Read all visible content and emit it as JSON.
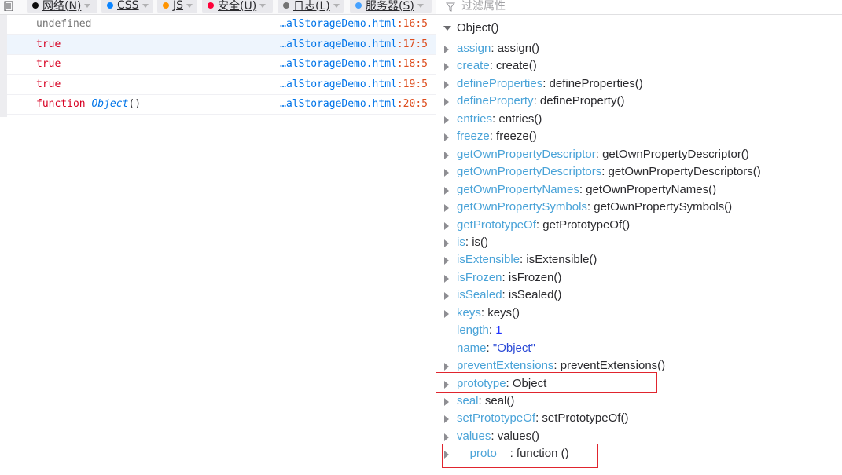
{
  "toolbar": {
    "filters": [
      {
        "label": "网络(N)",
        "dot_color": "#0c0c0d"
      },
      {
        "label": "CSS",
        "dot_color": "#0a84ff"
      },
      {
        "label": "JS",
        "dot_color": "#ff9400"
      },
      {
        "label": "安全(U)",
        "dot_color": "#ff0039"
      },
      {
        "label": "日志(L)",
        "dot_color": "#737373"
      },
      {
        "label": "服务器(S)",
        "dot_color": "#45a1ff"
      }
    ]
  },
  "console": {
    "messages": [
      {
        "text": "undefined",
        "type": "undefined",
        "file": "…alStorageDemo.html",
        "line": ":16:5"
      },
      {
        "text": "true",
        "type": "boolean",
        "file": "…alStorageDemo.html",
        "line": ":17:5"
      },
      {
        "text": "true",
        "type": "boolean",
        "file": "…alStorageDemo.html",
        "line": ":18:5"
      },
      {
        "text": "true",
        "type": "boolean",
        "file": "…alStorageDemo.html",
        "line": ":19:5"
      },
      {
        "keyword": "function",
        "name": "Object",
        "parens": "()",
        "type": "function",
        "file": "…alStorageDemo.html",
        "line": ":20:5"
      }
    ]
  },
  "sidebar": {
    "search_placeholder": "过滤属性",
    "root": "Object()",
    "properties": [
      {
        "key": "assign",
        "value": "assign()",
        "expandable": true
      },
      {
        "key": "create",
        "value": "create()",
        "expandable": true
      },
      {
        "key": "defineProperties",
        "value": "defineProperties()",
        "expandable": true
      },
      {
        "key": "defineProperty",
        "value": "defineProperty()",
        "expandable": true
      },
      {
        "key": "entries",
        "value": "entries()",
        "expandable": true
      },
      {
        "key": "freeze",
        "value": "freeze()",
        "expandable": true
      },
      {
        "key": "getOwnPropertyDescriptor",
        "value": "getOwnPropertyDescriptor()",
        "expandable": true
      },
      {
        "key": "getOwnPropertyDescriptors",
        "value": "getOwnPropertyDescriptors()",
        "expandable": true
      },
      {
        "key": "getOwnPropertyNames",
        "value": "getOwnPropertyNames()",
        "expandable": true
      },
      {
        "key": "getOwnPropertySymbols",
        "value": "getOwnPropertySymbols()",
        "expandable": true
      },
      {
        "key": "getPrototypeOf",
        "value": "getPrototypeOf()",
        "expandable": true
      },
      {
        "key": "is",
        "value": "is()",
        "expandable": true
      },
      {
        "key": "isExtensible",
        "value": "isExtensible()",
        "expandable": true
      },
      {
        "key": "isFrozen",
        "value": "isFrozen()",
        "expandable": true
      },
      {
        "key": "isSealed",
        "value": "isSealed()",
        "expandable": true
      },
      {
        "key": "keys",
        "value": "keys()",
        "expandable": true
      },
      {
        "key": "length",
        "value": "1",
        "expandable": false,
        "kind": "number"
      },
      {
        "key": "name",
        "value": "\"Object\"",
        "expandable": false,
        "kind": "string"
      },
      {
        "key": "preventExtensions",
        "value": "preventExtensions()",
        "expandable": true
      },
      {
        "key": "prototype",
        "value": "Object",
        "expandable": true,
        "highlighted": true
      },
      {
        "key": "seal",
        "value": "seal()",
        "expandable": true
      },
      {
        "key": "setPrototypeOf",
        "value": "setPrototypeOf()",
        "expandable": true
      },
      {
        "key": "values",
        "value": "values()",
        "expandable": true
      },
      {
        "key": "__proto__",
        "value": "function ()",
        "expandable": true,
        "highlighted": true
      }
    ]
  },
  "colors": {
    "highlight_border": "#e0252e",
    "property_key": "#4aa3d8",
    "location_link": "#0074e8",
    "location_line": "#dd4e1f",
    "boolean_value": "#d70022"
  }
}
